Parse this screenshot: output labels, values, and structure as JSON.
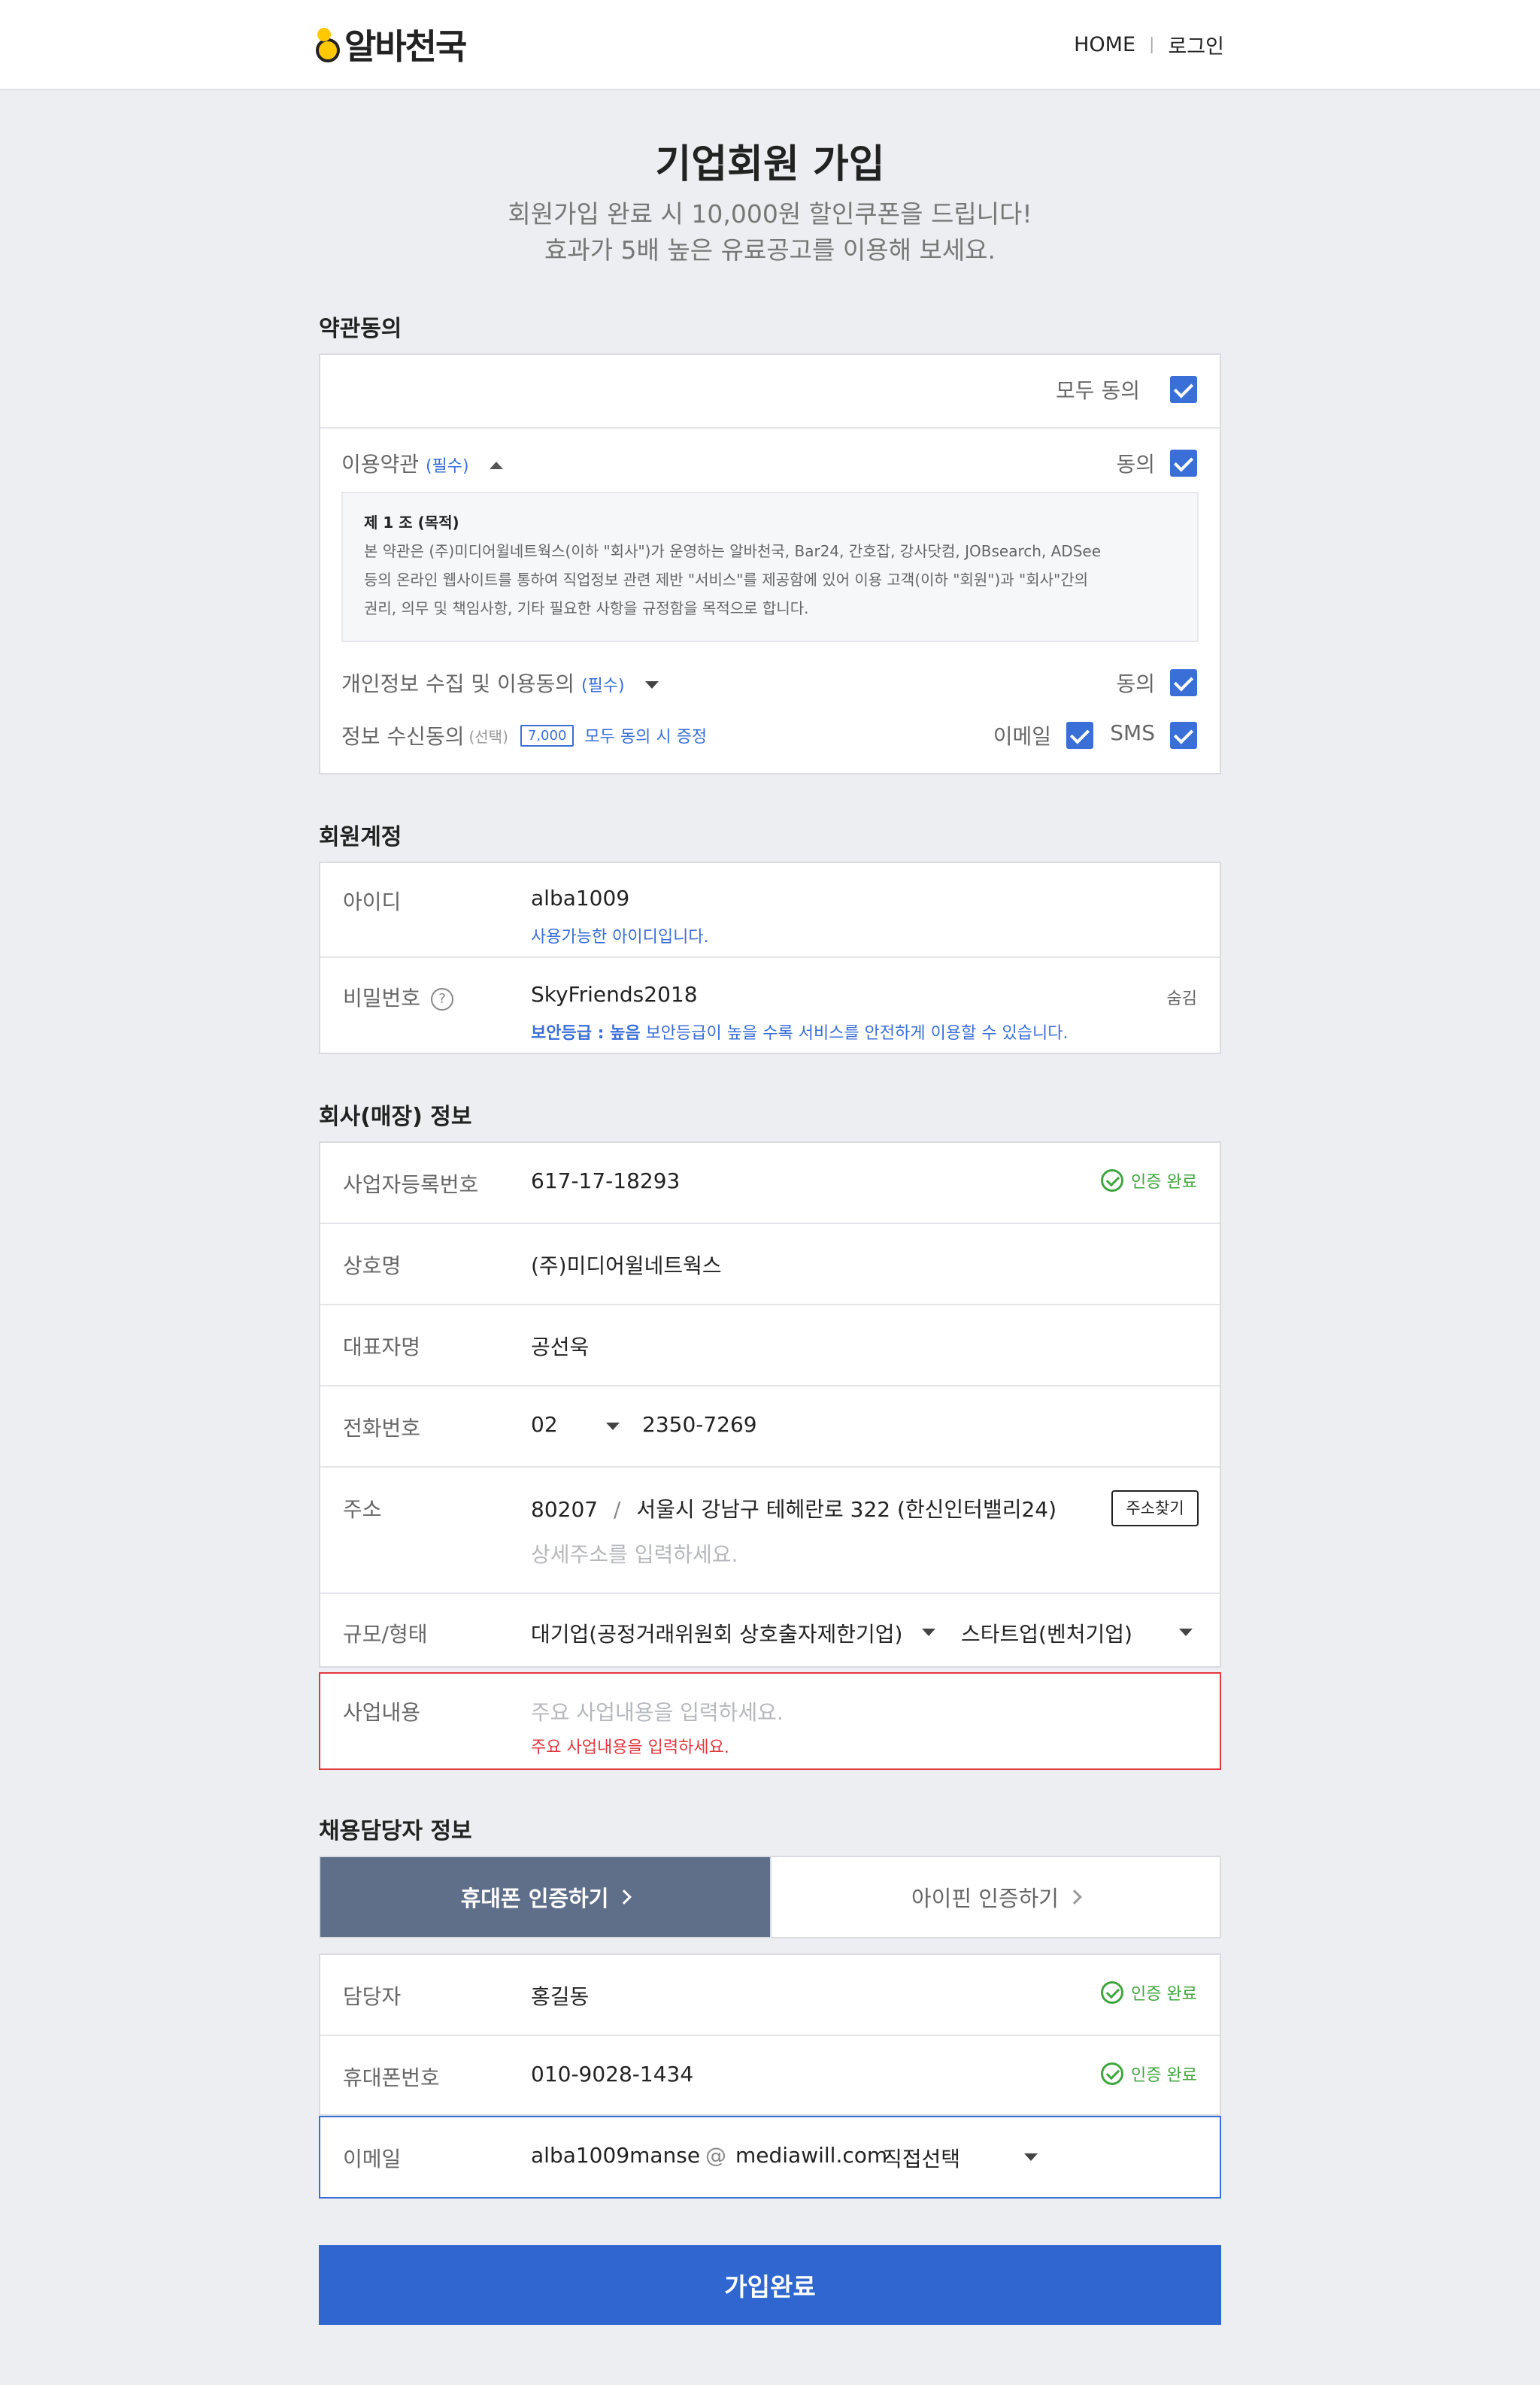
{
  "header": {
    "logo_text": "알바천국",
    "nav_home": "HOME",
    "nav_login": "로그인",
    "nav_separator": "|"
  },
  "page": {
    "title": "기업회원 가입",
    "subtitle_line1": "회원가입 완료 시 10,000원 할인쿠폰을 드립니다!",
    "subtitle_line2": "효과가 5배 높은 유료공고를 이용해 보세요."
  },
  "terms": {
    "section_title": "약관동의",
    "agree_all": "모두 동의",
    "tos_label": "이용약관",
    "tos_required": "(필수)",
    "tos_agree": "동의",
    "tos_body_title": "제 1 조 (목적)",
    "tos_body_line1": "본 약관은 (주)미디어윌네트웍스(이하 \"회사\")가 운영하는 알바천국, Bar24, 간호잡, 강사닷컴, JOBsearch, ADSee",
    "tos_body_line2": "등의 온라인 웹사이트를 통하여 직업정보 관련 제반 \"서비스\"를 제공함에 있어 이용 고객(이하 \"회원\")과 \"회사\"간의",
    "tos_body_line3": "권리, 의무 및 책임사항, 기타 필요한 사항을 규정함을 목적으로 합니다.",
    "privacy_label": "개인정보 수집 및 이용동의",
    "privacy_required": "(필수)",
    "privacy_agree": "동의",
    "marketing_label": "정보 수신동의",
    "marketing_optional": "(선택)",
    "coupon_badge": "7,000",
    "coupon_text": "모두 동의 시 증정",
    "email_label": "이메일",
    "sms_label": "SMS"
  },
  "account": {
    "section_title": "회원계정",
    "id_label": "아이디",
    "id_value": "alba1009",
    "id_hint": "사용가능한 아이디입니다.",
    "pw_label": "비밀번호",
    "pw_help": "?",
    "pw_value": "SkyFriends2018",
    "pw_hide": "숨김",
    "pw_level": "보안등급 : 높음",
    "pw_hint": "보안등급이 높을 수록 서비스를 안전하게 이용할 수 있습니다."
  },
  "company": {
    "section_title": "회사(매장) 정보",
    "biz_no_label": "사업자등록번호",
    "biz_no_value": "617-17-18293",
    "verified_text": "인증 완료",
    "name_label": "상호명",
    "name_value": "(주)미디어윌네트웍스",
    "ceo_label": "대표자명",
    "ceo_value": "공선욱",
    "phone_label": "전화번호",
    "phone_area": "02",
    "phone_number": "2350-7269",
    "address_label": "주소",
    "zip": "80207",
    "address_sep": "/",
    "address": "서울시 강남구 테헤란로 322 (한신인터밸리24)",
    "address_find": "주소찾기",
    "address_detail_placeholder": "상세주소를 입력하세요.",
    "scale_label": "규모/형태",
    "scale_value": "대기업(공정거래위원회 상호출자제한기업)",
    "type_value": "스타트업(벤처기업)",
    "business_label": "사업내용",
    "business_placeholder": "주요 사업내용을 입력하세요.",
    "business_error": "주요 사업내용을 입력하세요."
  },
  "manager": {
    "section_title": "채용담당자 정보",
    "tab_phone": "휴대폰 인증하기",
    "tab_ipin": "아이핀 인증하기",
    "name_label": "담당자",
    "name_value": "홍길동",
    "verified_text": "인증 완료",
    "mobile_label": "휴대폰번호",
    "mobile_value": "010-9028-1434",
    "email_label": "이메일",
    "email_id": "alba1009manse",
    "email_at": "@",
    "email_domain": "mediawill.com",
    "email_select": "직접선택"
  },
  "submit_label": "가입완료",
  "colors": {
    "accent": "#2f66d0",
    "check": "#3a6fd8",
    "verified": "#3fa63f",
    "error": "#e2383f",
    "tab_active": "#5f6f8a"
  }
}
